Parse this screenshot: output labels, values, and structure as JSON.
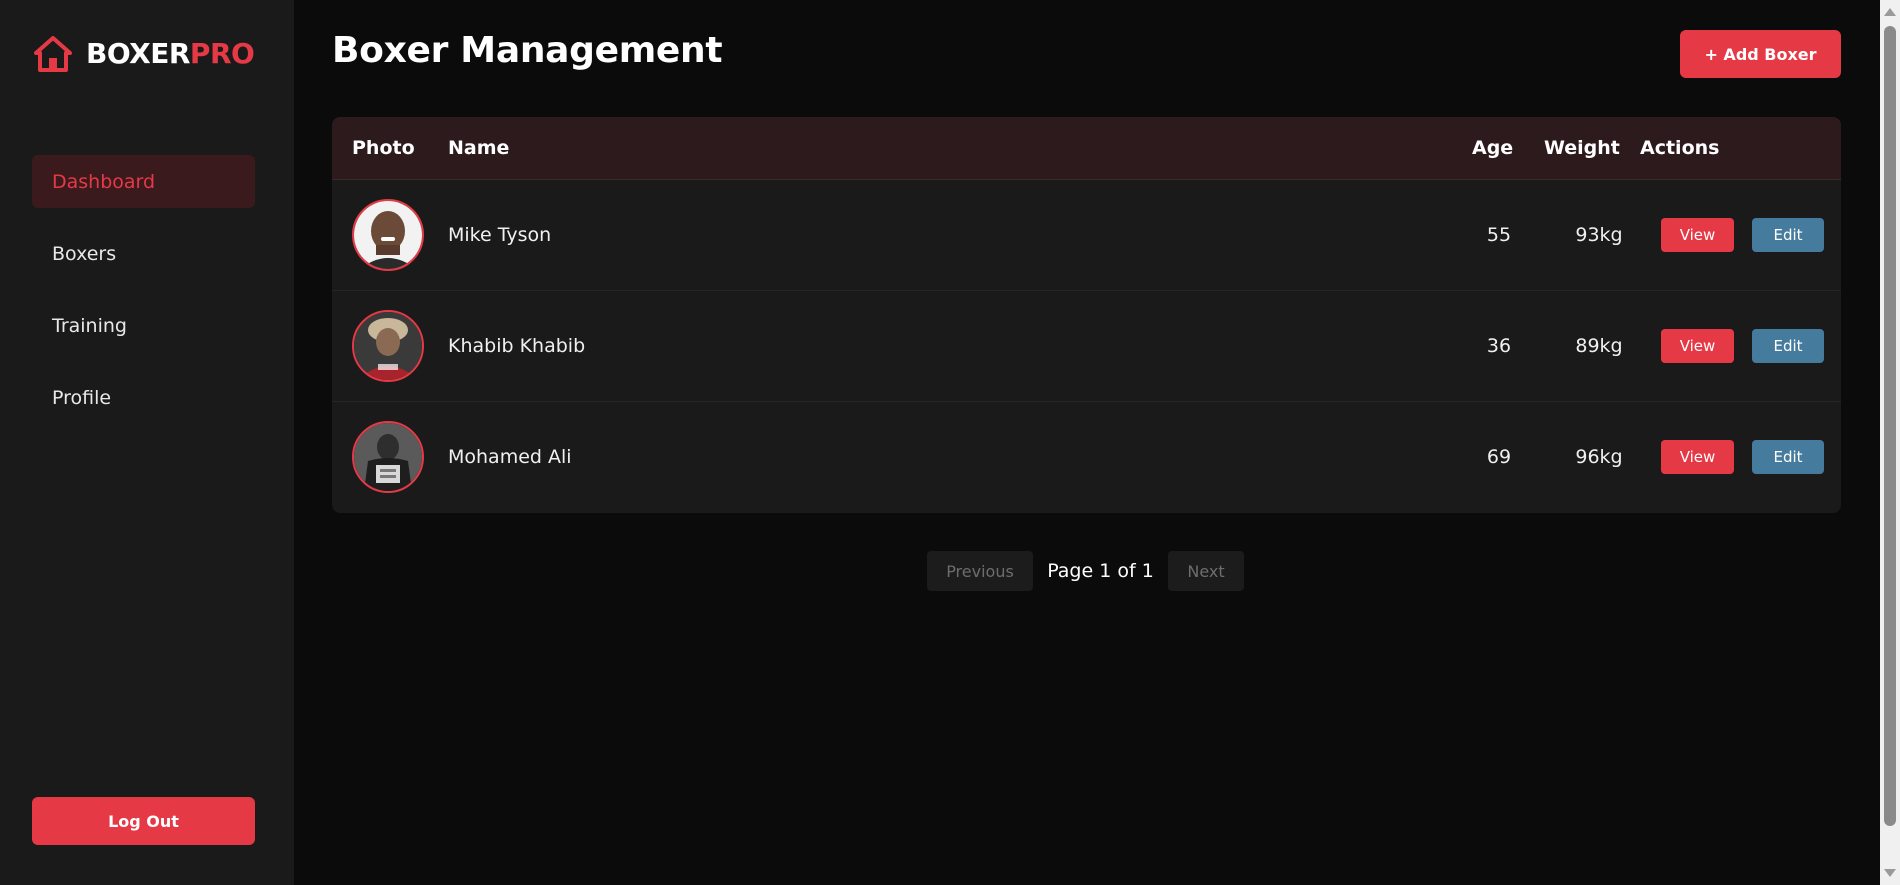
{
  "sidebar": {
    "logo": {
      "part1": "BOXER",
      "part2": "PRO",
      "icon": "home-icon"
    },
    "items": [
      {
        "label": "Dashboard",
        "active": true
      },
      {
        "label": "Boxers",
        "active": false
      },
      {
        "label": "Training",
        "active": false
      },
      {
        "label": "Profile",
        "active": false
      }
    ],
    "logout_label": "Log Out"
  },
  "header": {
    "title": "Boxer Management",
    "add_label": "+ Add Boxer"
  },
  "table": {
    "columns": {
      "photo": "Photo",
      "name": "Name",
      "age": "Age",
      "weight": "Weight",
      "actions": "Actions"
    },
    "rows": [
      {
        "name": "Mike Tyson",
        "age": "55",
        "weight": "93kg",
        "view_label": "View",
        "edit_label": "Edit"
      },
      {
        "name": "Khabib Khabib",
        "age": "36",
        "weight": "89kg",
        "view_label": "View",
        "edit_label": "Edit"
      },
      {
        "name": "Mohamed Ali",
        "age": "69",
        "weight": "96kg",
        "view_label": "View",
        "edit_label": "Edit"
      }
    ]
  },
  "pagination": {
    "prev_label": "Previous",
    "info": "Page 1 of 1",
    "next_label": "Next"
  },
  "colors": {
    "accent": "#e63946",
    "edit": "#457b9d",
    "sidebar_bg": "#1a1a1a",
    "page_bg": "#0b0b0b",
    "table_header_bg": "#2d1a1d"
  }
}
